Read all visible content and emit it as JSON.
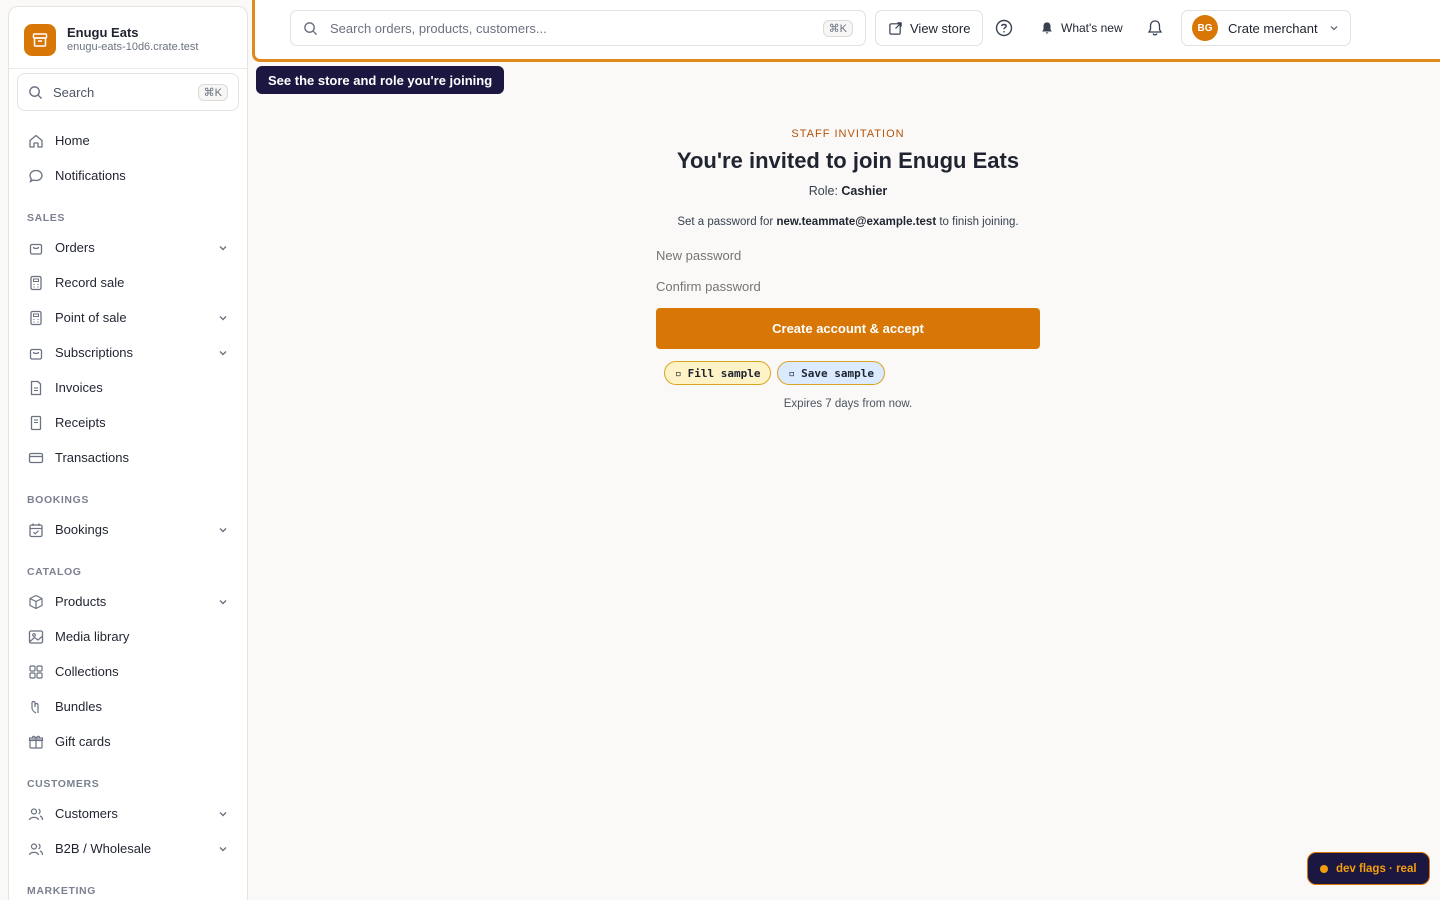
{
  "store": {
    "name": "Enugu Eats",
    "url": "enugu-eats-10d6.crate.test"
  },
  "sidebar": {
    "search_label": "Search",
    "search_shortcut": "⌘K",
    "top_items": [
      {
        "label": "Home",
        "icon": "home-icon"
      },
      {
        "label": "Notifications",
        "icon": "chat-bubble-icon"
      }
    ],
    "sections": {
      "sales": "SALES",
      "bookings": "BOOKINGS",
      "catalog": "CATALOG",
      "customers": "CUSTOMERS",
      "marketing": "MARKETING"
    },
    "sales_items": [
      "Orders",
      "Record sale",
      "Point of sale",
      "Subscriptions",
      "Invoices",
      "Receipts",
      "Transactions"
    ],
    "bookings_items": [
      "Bookings"
    ],
    "catalog_items": [
      "Products",
      "Media library",
      "Collections",
      "Bundles",
      "Gift cards"
    ],
    "customers_items": [
      "Customers",
      "B2B / Wholesale"
    ]
  },
  "topbar": {
    "search_placeholder": "Search orders, products, customers...",
    "search_shortcut": "⌘K",
    "view_store": "View store",
    "whats_new": "What's new",
    "account": "Crate merchant",
    "avatar_initials": "BG"
  },
  "tooltip": "See the store and role you're joining",
  "invite": {
    "eyebrow": "STAFF INVITATION",
    "title": "You're invited to join Enugu Eats",
    "role_label": "Role:",
    "role_value": "Cashier",
    "set_prefix": "Set a password for",
    "email": "new.teammate@example.test",
    "set_suffix": "to finish joining.",
    "new_password_placeholder": "New password",
    "confirm_password_placeholder": "Confirm password",
    "submit": "Create account & accept",
    "fill_sample": "Fill sample",
    "save_sample": "Save sample",
    "expires": "Expires 7 days from now."
  },
  "devflags": "dev flags · real",
  "colors": {
    "accent": "#d97706",
    "dark": "#1b1740"
  }
}
